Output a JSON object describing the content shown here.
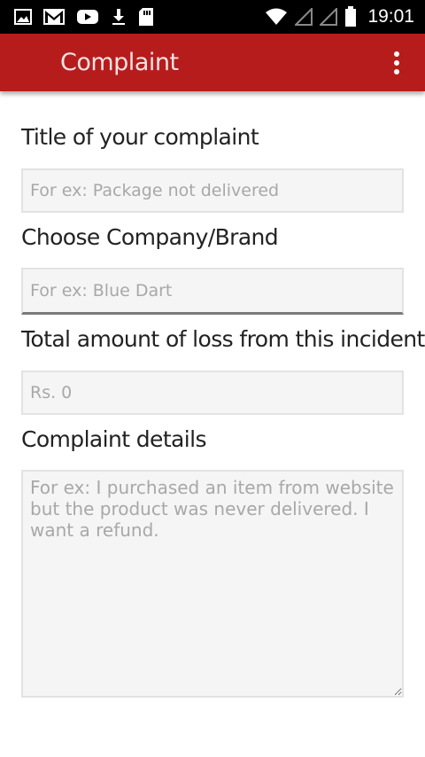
{
  "status_bar": {
    "time": "19:01",
    "left_icons": [
      "image-icon",
      "gmail-icon",
      "youtube-icon",
      "download-icon",
      "sd-card-icon"
    ],
    "right_icons": [
      "wifi-icon",
      "signal-icon",
      "signal-icon",
      "battery-icon"
    ]
  },
  "app_bar": {
    "title": "Complaint",
    "menu_icon": "overflow-menu-icon",
    "accent": "#b71c1c"
  },
  "form": {
    "title_label": "Title of your complaint",
    "title_placeholder": "For ex: Package not delivered",
    "company_label": "Choose Company/Brand",
    "company_placeholder": "For ex: Blue Dart",
    "loss_label": "Total amount of loss from this incident",
    "loss_placeholder": "Rs. 0",
    "details_label": "Complaint details",
    "details_placeholder": "For ex: I purchased an item from website but the product was never delivered. I want a refund."
  }
}
